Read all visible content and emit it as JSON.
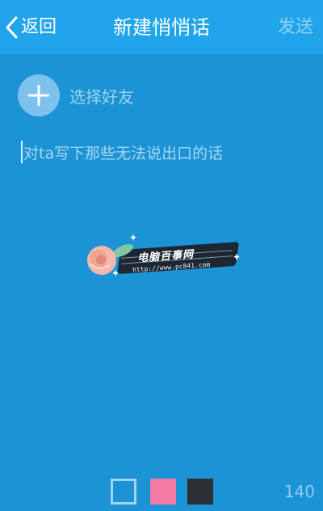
{
  "header": {
    "back_label": "返回",
    "title": "新建悄悄话",
    "send_label": "发送"
  },
  "friend_picker": {
    "label": "选择好友"
  },
  "message": {
    "placeholder": "对ta写下那些无法说出口的话"
  },
  "watermark": {
    "title": "电脑百事网",
    "url": "http://www.pc841.com"
  },
  "color_options": [
    {
      "name": "outline",
      "color": "#9fd6f5",
      "selected": true
    },
    {
      "name": "pink",
      "color": "#f47aa6"
    },
    {
      "name": "dark",
      "color": "#2c2f33"
    }
  ],
  "char_counter": "140",
  "colors": {
    "background": "#1c93d5",
    "header": "#21a4ea"
  }
}
